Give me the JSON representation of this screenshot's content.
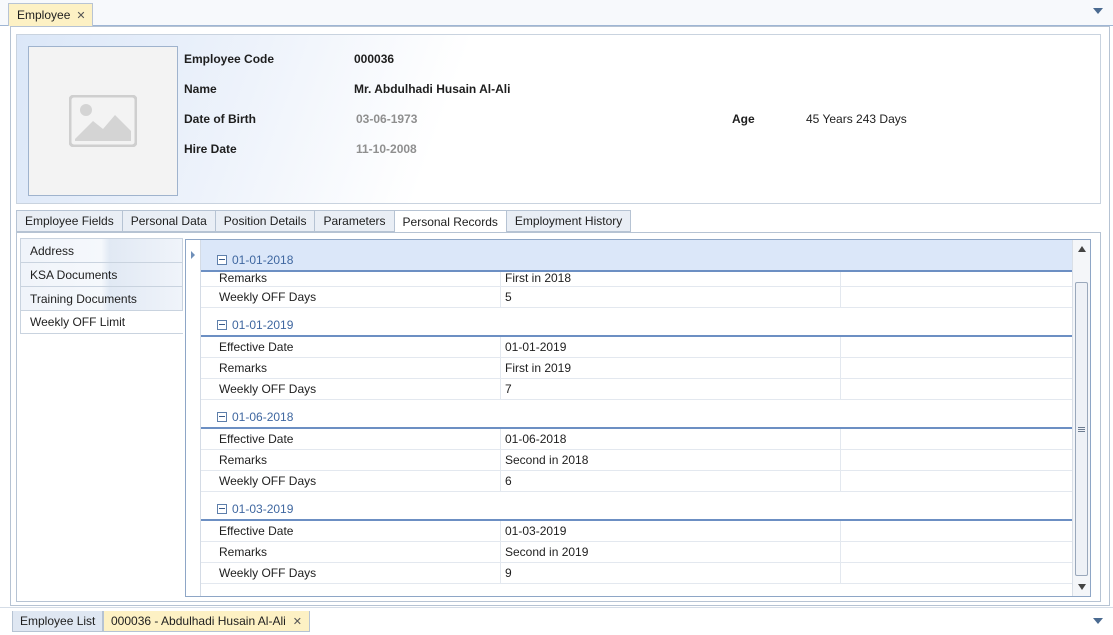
{
  "top_tab": {
    "label": "Employee",
    "close": "✕"
  },
  "header": {
    "employee_code_label": "Employee Code",
    "employee_code": "000036",
    "name_label": "Name",
    "name": "Mr. Abdulhadi Husain Al-Ali",
    "dob_label": "Date of Birth",
    "dob": "03-06-1973",
    "hire_date_label": "Hire Date",
    "hire_date": "11-10-2008",
    "age_label": "Age",
    "age": "45 Years 243 Days"
  },
  "tabs": [
    {
      "label": "Employee Fields"
    },
    {
      "label": "Personal Data"
    },
    {
      "label": "Position Details"
    },
    {
      "label": "Parameters"
    },
    {
      "label": "Personal Records",
      "active": true
    },
    {
      "label": "Employment History"
    }
  ],
  "side_items": [
    {
      "label": "Address"
    },
    {
      "label": "KSA Documents"
    },
    {
      "label": "Training Documents"
    },
    {
      "label": "Weekly OFF Limit",
      "active": true
    }
  ],
  "groups": [
    {
      "title": "01-01-2018",
      "rows": [
        {
          "field": "Remarks",
          "value": "First in 2018"
        },
        {
          "field": "Weekly OFF Days",
          "value": "5"
        }
      ]
    },
    {
      "title": "01-01-2019",
      "rows": [
        {
          "field": "Effective Date",
          "value": "01-01-2019"
        },
        {
          "field": "Remarks",
          "value": "First in 2019"
        },
        {
          "field": "Weekly OFF Days",
          "value": "7"
        }
      ]
    },
    {
      "title": "01-06-2018",
      "rows": [
        {
          "field": "Effective Date",
          "value": "01-06-2018"
        },
        {
          "field": "Remarks",
          "value": "Second in 2018"
        },
        {
          "field": "Weekly OFF Days",
          "value": "6"
        }
      ]
    },
    {
      "title": "01-03-2019",
      "rows": [
        {
          "field": "Effective Date",
          "value": "01-03-2019"
        },
        {
          "field": "Remarks",
          "value": "Second in 2019"
        },
        {
          "field": "Weekly OFF Days",
          "value": "9"
        }
      ]
    }
  ],
  "bottom_tabs": {
    "list_label": "Employee List",
    "emp_label": "000036 - Abdulhadi Husain Al-Ali",
    "close": "✕"
  },
  "colors": {
    "accent": "#6c8fc3",
    "active_doc_tab": "#fdf1c4",
    "group_title": "#3f67a0"
  }
}
